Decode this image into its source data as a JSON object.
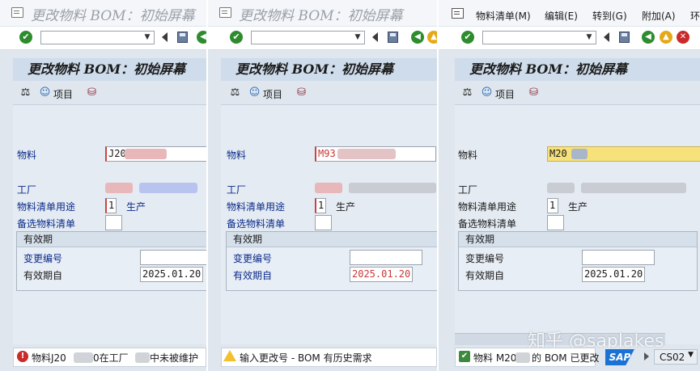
{
  "panels": [
    {
      "window_title": "更改物料 BOM：初始屏幕",
      "screen_title": "更改物料 BOM：初始屏幕",
      "appbar_item_label": "项目",
      "fields": {
        "material_label": "物料",
        "material_value": "J20",
        "plant_label": "工厂",
        "bom_usage_label": "物料清单用途",
        "bom_usage_value": "1",
        "bom_usage_text": "生产",
        "alt_bom_label": "备选物料清单",
        "validity_group": "有效期",
        "change_no_label": "变更编号",
        "valid_from_label": "有效期自",
        "valid_from_value": "2025.01.20"
      },
      "status": {
        "type": "error",
        "text_a": "物料J20",
        "text_b": "0在工厂",
        "text_c": "中未被维护"
      }
    },
    {
      "window_title": "更改物料 BOM：初始屏幕",
      "screen_title": "更改物料 BOM：初始屏幕",
      "appbar_item_label": "项目",
      "fields": {
        "material_label": "物料",
        "material_value": "M93",
        "plant_label": "工厂",
        "bom_usage_label": "物料清单用途",
        "bom_usage_value": "1",
        "bom_usage_text": "生产",
        "alt_bom_label": "备选物料清单",
        "validity_group": "有效期",
        "change_no_label": "变更编号",
        "valid_from_label": "有效期自",
        "valid_from_value": "2025.01.20"
      },
      "status": {
        "type": "warning",
        "text": "输入更改号 - BOM 有历史需求"
      }
    },
    {
      "menu": [
        "物料清单(M)",
        "编辑(E)",
        "转到(G)",
        "附加(A)",
        "环"
      ],
      "screen_title": "更改物料 BOM：初始屏幕",
      "appbar_item_label": "项目",
      "fields": {
        "material_label": "物料",
        "material_value": "M20",
        "plant_label": "工厂",
        "bom_usage_label": "物料清单用途",
        "bom_usage_value": "1",
        "bom_usage_text": "生产",
        "alt_bom_label": "备选物料清单",
        "validity_group": "有效期",
        "change_no_label": "变更编号",
        "valid_from_label": "有效期自",
        "valid_from_value": "2025.01.20"
      },
      "status": {
        "type": "success",
        "text_a": "物料 M20",
        "text_b": "的 BOM 已更改"
      },
      "sap_logo": "SAP",
      "transaction": "CS02",
      "watermark": "知乎 @saplakes"
    }
  ],
  "colors": {
    "title_bar_bg": "#cfdceb",
    "label_blue": "#0a2a8a",
    "required_red": "#c84444",
    "date_red": "#c83838",
    "highlight_yellow": "#f7e17a"
  }
}
